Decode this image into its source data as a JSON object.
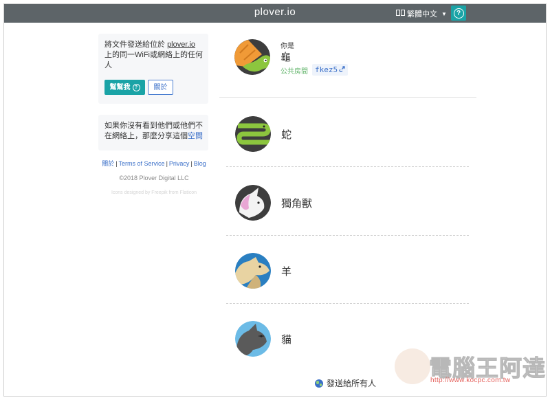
{
  "topbar": {
    "brand": "plover.io",
    "language": "繁體中文",
    "help_icon": "question-circle-icon"
  },
  "info_card": {
    "line1_prefix": "將文件發送給位於 ",
    "line1_link": "plover.io",
    "line2": "上的同一WiFi或網絡上的任何人",
    "help_label": "幫幫我",
    "about_label": "關於"
  },
  "share_card": {
    "text": "如果你沒有看到他們或他們不在網絡上，那麼分享這個",
    "link": "空間"
  },
  "footer": {
    "links": [
      "關於",
      "Terms of Service",
      "Privacy",
      "Blog"
    ],
    "copyright": "©2018 Plover Digital LLC",
    "credit": "Icons designed by Freepik from Flaticon"
  },
  "me": {
    "you_label": "你是",
    "name": "龜",
    "room_label": "公共房間",
    "room_code": "fkez5",
    "avatar_icon": "turtle-icon"
  },
  "peers": [
    {
      "name": "蛇",
      "icon": "snake-icon"
    },
    {
      "name": "獨角獸",
      "icon": "unicorn-icon"
    },
    {
      "name": "羊",
      "icon": "sheep-icon"
    },
    {
      "name": "貓",
      "icon": "cat-icon"
    }
  ],
  "send_all": {
    "label": "發送給所有人",
    "icon": "globe-icon"
  },
  "watermark": {
    "title": "電腦王阿達",
    "url": "http://www.kocpc.com.tw"
  },
  "colors": {
    "topbar": "#5d6468",
    "accent": "#1aa3a6",
    "link": "#3a6fc8",
    "green": "#5fb368"
  }
}
